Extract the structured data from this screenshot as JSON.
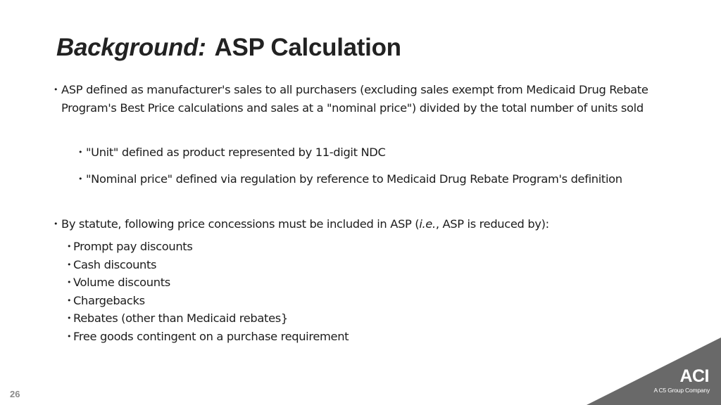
{
  "slide": {
    "title_italic": "Background:",
    "title_main": "ASP Calculation",
    "page_number": "26"
  },
  "bullets": {
    "b1": "ASP defined as manufacturer's sales to all purchasers (excluding sales exempt from Medicaid Drug Rebate Program's Best Price calculations and sales at a \"nominal price\") divided by the total number of units sold",
    "b1_sub": [
      "\"Unit\" defined as product represented by 11-digit NDC",
      "\"Nominal price\" defined via regulation by reference to Medicaid Drug Rebate Program's definition"
    ],
    "b2_prefix": "By statute, following price concessions must be included in ASP (",
    "b2_italic": "i.e.",
    "b2_suffix": ", ASP is reduced by):",
    "b2_sub": [
      "Prompt pay discounts",
      "Cash discounts",
      "Volume discounts",
      "Chargebacks",
      "Rebates (other than Medicaid rebates}",
      "Free goods contingent on a purchase requirement"
    ],
    "bullet_glyph": "•"
  },
  "brand": {
    "logo_text": "ACI",
    "tagline": "A C5 Group Company",
    "corner_color": "#696969"
  }
}
